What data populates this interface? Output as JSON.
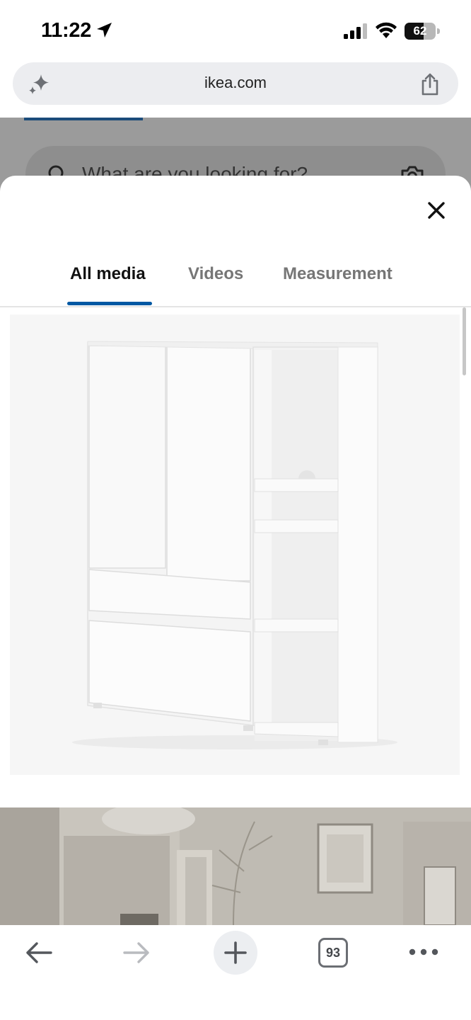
{
  "status_bar": {
    "time": "11:22",
    "battery_level": "62",
    "battery_fraction": 0.62
  },
  "browser": {
    "url": "ikea.com",
    "icons": [
      "sparkle-icon",
      "share-icon"
    ]
  },
  "page_behind": {
    "search_placeholder": "What are you looking for?"
  },
  "media_modal": {
    "tabs": [
      {
        "label": "All media",
        "active": true
      },
      {
        "label": "Videos",
        "active": false
      },
      {
        "label": "Measurement",
        "active": false
      }
    ],
    "accent_color": "#0058a3"
  },
  "toolbar": {
    "tabs_count": "93",
    "icons": [
      "back-arrow-icon",
      "forward-arrow-icon",
      "plus-icon",
      "tabs-icon",
      "more-icon"
    ]
  }
}
